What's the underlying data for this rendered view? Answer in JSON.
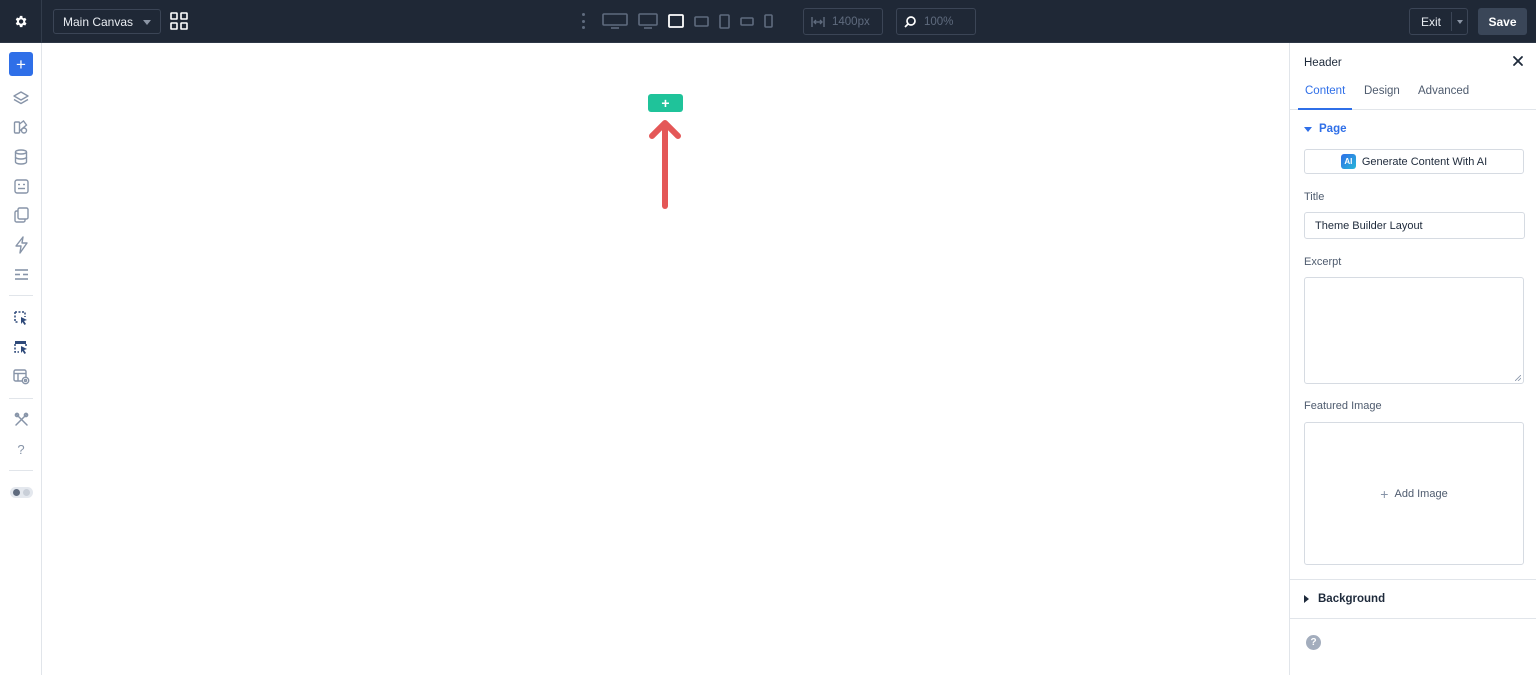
{
  "topbar": {
    "settings_icon": "gear-icon",
    "canvas_select": "Main Canvas",
    "grid_icon": "grid-icon",
    "device_icons": [
      "desktop-wide-icon",
      "desktop-icon",
      "laptop-icon",
      "tablet-landscape-icon",
      "tablet-icon",
      "phone-landscape-icon",
      "phone-icon"
    ],
    "active_device": "laptop-icon",
    "width_value": "1400px",
    "zoom_value": "100%",
    "exit_label": "Exit",
    "save_label": "Save"
  },
  "leftbar": {
    "items": [
      "add-icon",
      "layers-icon",
      "presets-icon",
      "database-icon",
      "forms-icon",
      "pages-icon",
      "lightning-icon",
      "fields-icon",
      "select-tool-icon",
      "multi-select-icon",
      "layout-preview-icon",
      "tools-icon",
      "help-icon"
    ],
    "help_glyph": "?",
    "add_glyph": "+"
  },
  "canvas": {
    "add_section_glyph": "+",
    "arrow_color": "#e45757",
    "accent": "#1fc39a"
  },
  "panel": {
    "title": "Header",
    "tabs": [
      {
        "label": "Content",
        "active": true
      },
      {
        "label": "Design",
        "active": false
      },
      {
        "label": "Advanced",
        "active": false
      }
    ],
    "page_section": "Page",
    "ai_badge": "AI",
    "ai_button": "Generate Content With AI",
    "title_label": "Title",
    "title_value": "Theme Builder Layout",
    "excerpt_label": "Excerpt",
    "excerpt_value": "",
    "featured_label": "Featured Image",
    "add_image_glyph": "+",
    "add_image": "Add Image",
    "background_section": "Background",
    "help_glyph": "?"
  },
  "colors": {
    "topbar_bg": "#1f2836",
    "primary": "#2f6fe8",
    "add_green": "#1fc39a"
  }
}
